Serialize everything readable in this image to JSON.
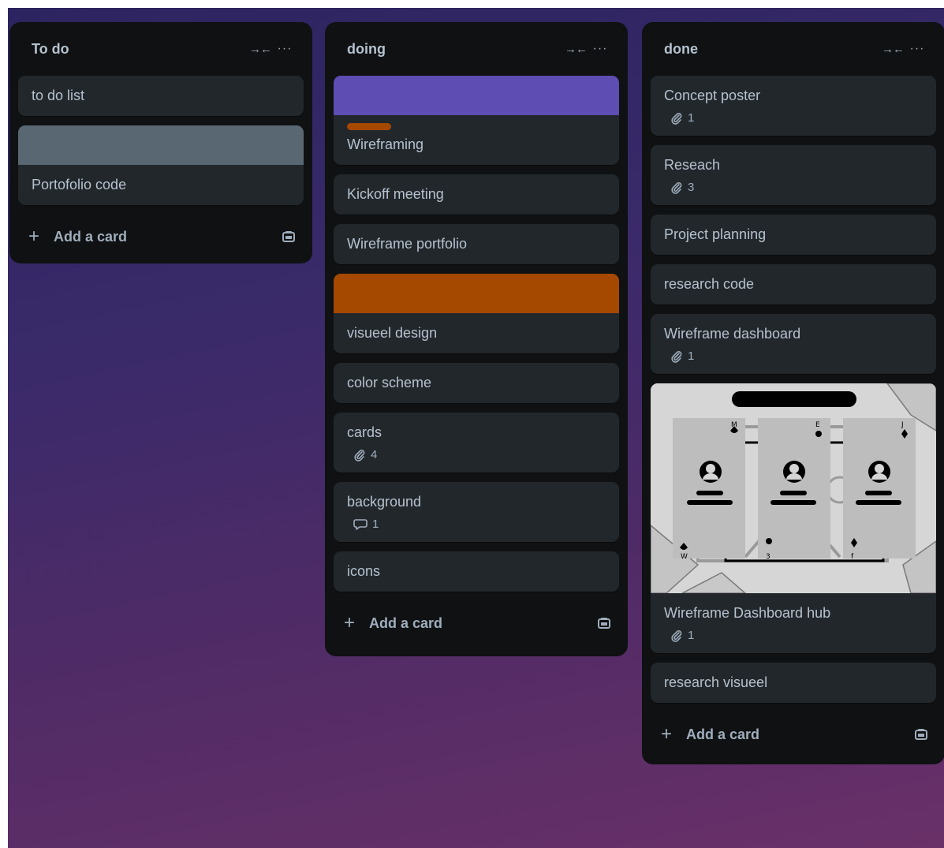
{
  "lists": [
    {
      "title": "To do",
      "collapse_icon": "collapse-icon",
      "more_icon": "more-icon",
      "add_card_label": "Add a card",
      "cards": [
        {
          "title": "to do list"
        },
        {
          "title": "Portofolio code",
          "cover_color": "#596773"
        }
      ]
    },
    {
      "title": "doing",
      "add_card_label": "Add a card",
      "cards": [
        {
          "title": "Wireframing",
          "cover_color": "#5e4db2",
          "label_color": "#a54800"
        },
        {
          "title": "Kickoff meeting"
        },
        {
          "title": "Wireframe portfolio"
        },
        {
          "title": "visueel design",
          "cover_color": "#a54800"
        },
        {
          "title": "color scheme"
        },
        {
          "title": "cards",
          "attachments": "4"
        },
        {
          "title": "background",
          "comments": "1"
        },
        {
          "title": "icons"
        }
      ]
    },
    {
      "title": "done",
      "add_card_label": "Add a card",
      "cards": [
        {
          "title": "Concept poster",
          "attachments": "1"
        },
        {
          "title": "Reseach",
          "attachments": "3"
        },
        {
          "title": "Project planning"
        },
        {
          "title": "research code"
        },
        {
          "title": "Wireframe dashboard",
          "attachments": "1"
        },
        {
          "title": "Wireframe Dashboard hub",
          "attachments": "1",
          "cover_image": "wireframe-cards-image"
        },
        {
          "title": "research visueel"
        }
      ]
    }
  ],
  "colors": {
    "list_bg": "#0f1112",
    "card_bg": "#22272b",
    "text": "#b6c2cf",
    "muted": "#9fadbc"
  },
  "icons": {
    "collapse": "collapse-arrows-icon",
    "more": "ellipsis-icon",
    "add": "plus-icon",
    "template": "card-template-icon",
    "attachment": "paperclip-icon",
    "comment": "comment-icon"
  },
  "playing_card_letters": {
    "card_1_top": "M",
    "card_1_bottom": "W",
    "card_2_top": "E",
    "card_2_bottom": "3",
    "card_3_top": "J",
    "card_3_bottom": "f"
  }
}
